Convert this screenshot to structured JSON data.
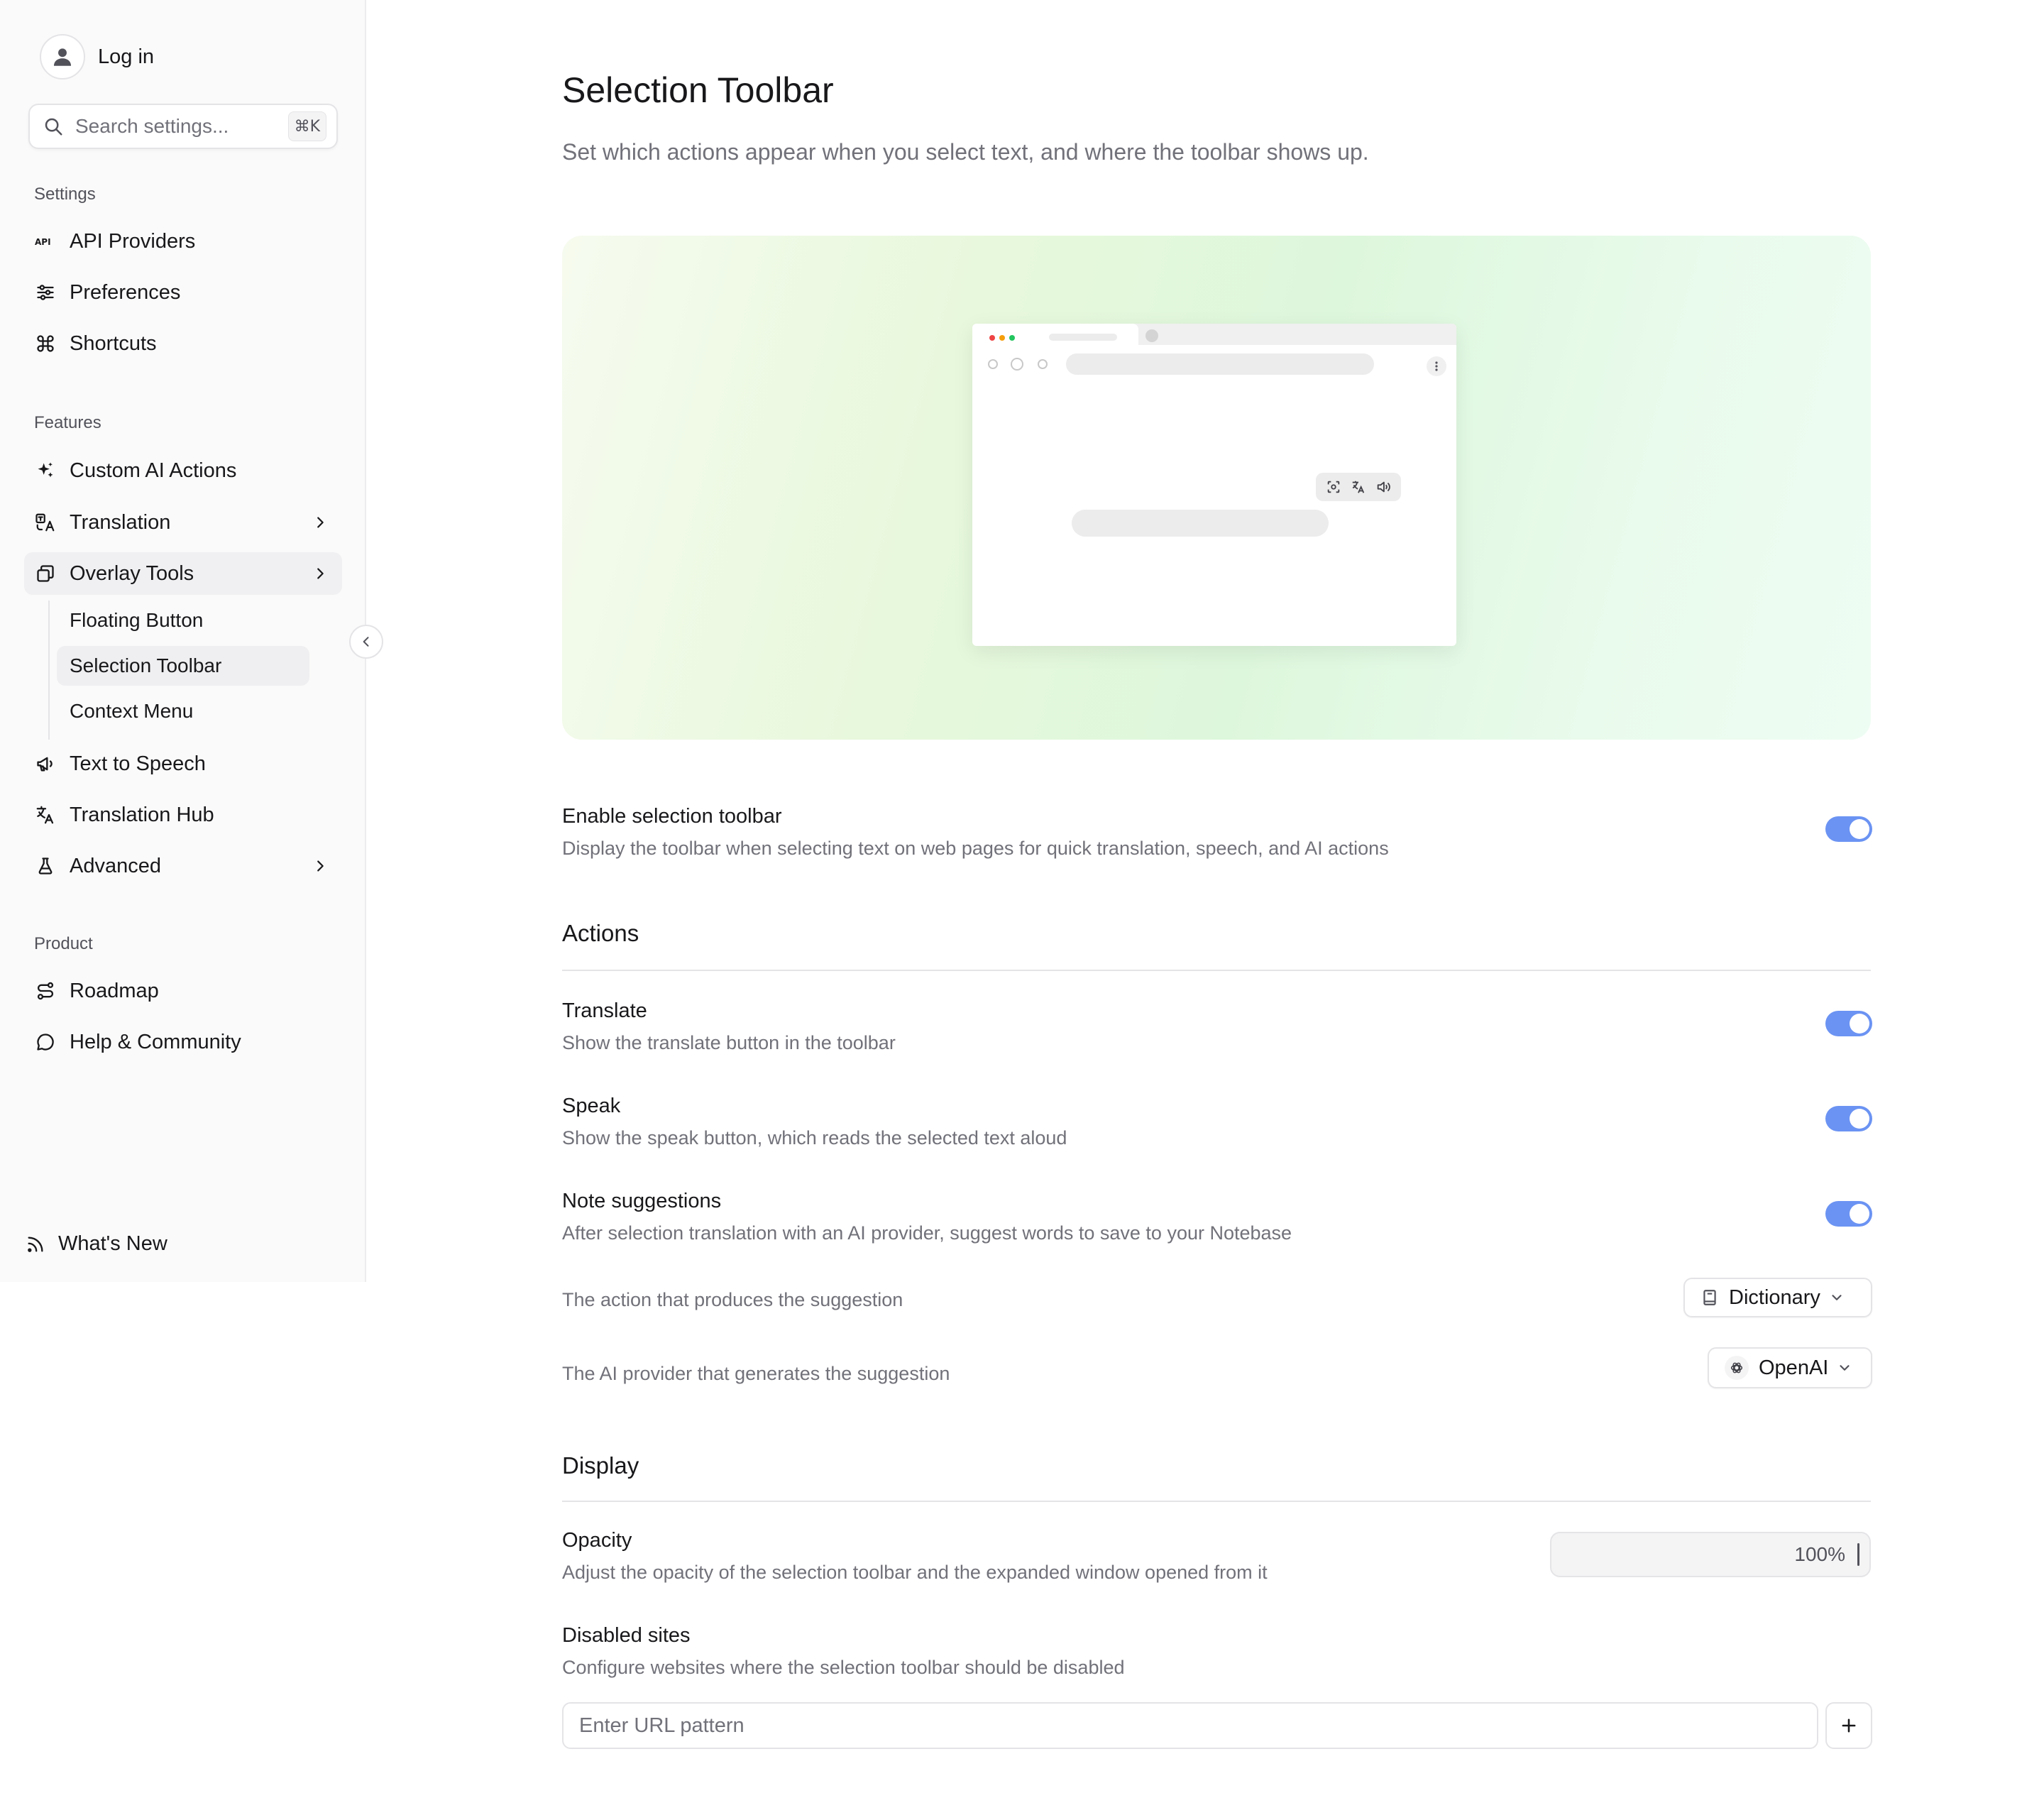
{
  "sidebar": {
    "login_label": "Log in",
    "search_placeholder": "Search settings...",
    "search_shortcut": "⌘K",
    "groups": {
      "settings": "Settings",
      "features": "Features",
      "product": "Product"
    },
    "settings_items": {
      "api_providers": "API Providers",
      "preferences": "Preferences",
      "shortcuts": "Shortcuts"
    },
    "features_items": {
      "custom_ai_actions": "Custom AI Actions",
      "translation": "Translation",
      "overlay_tools": "Overlay Tools",
      "text_to_speech": "Text to Speech",
      "translation_hub": "Translation Hub",
      "advanced": "Advanced"
    },
    "overlay_sub": {
      "floating_button": "Floating Button",
      "selection_toolbar": "Selection Toolbar",
      "context_menu": "Context Menu"
    },
    "product_items": {
      "roadmap": "Roadmap",
      "help_community": "Help & Community"
    },
    "whats_new": "What's New",
    "icons": [
      "user-icon",
      "search-icon",
      "api-icon",
      "sliders-icon",
      "command-icon",
      "sparkles-icon",
      "languages-icon",
      "layers-icon",
      "megaphone-icon",
      "translate-icon",
      "flask-icon",
      "route-icon",
      "chat-bubble-icon",
      "rss-icon",
      "chevron-left-icon",
      "chevron-right-icon"
    ]
  },
  "main": {
    "title": "Selection Toolbar",
    "subtitle": "Set which actions appear when you select text, and where the toolbar shows up.",
    "enable": {
      "title": "Enable selection toolbar",
      "description": "Display the toolbar when selecting text on web pages for quick translation, speech, and AI actions",
      "enabled": true
    },
    "actions": {
      "heading": "Actions",
      "translate": {
        "title": "Translate",
        "description": "Show the translate button in the toolbar",
        "enabled": true
      },
      "speak": {
        "title": "Speak",
        "description": "Show the speak button, which reads the selected text aloud",
        "enabled": true
      },
      "note_suggestions": {
        "title": "Note suggestions",
        "description": "After selection translation with an AI provider, suggest words to save to your Notebase",
        "enabled": true
      },
      "suggestion_action": {
        "label": "The action that produces the suggestion",
        "value": "Dictionary"
      },
      "suggestion_provider": {
        "label": "The AI provider that generates the suggestion",
        "value": "OpenAI"
      }
    },
    "display": {
      "heading": "Display",
      "opacity": {
        "title": "Opacity",
        "description": "Adjust the opacity of the selection toolbar and the expanded window opened from it",
        "value": "100%"
      },
      "disabled_sites": {
        "title": "Disabled sites",
        "description": "Configure websites where the selection toolbar should be disabled",
        "placeholder": "Enter URL pattern"
      }
    }
  },
  "colors": {
    "accent_toggle": "#6b93f3",
    "sidebar_bg": "#fafafa",
    "hero_green": "#ddf7dc"
  }
}
